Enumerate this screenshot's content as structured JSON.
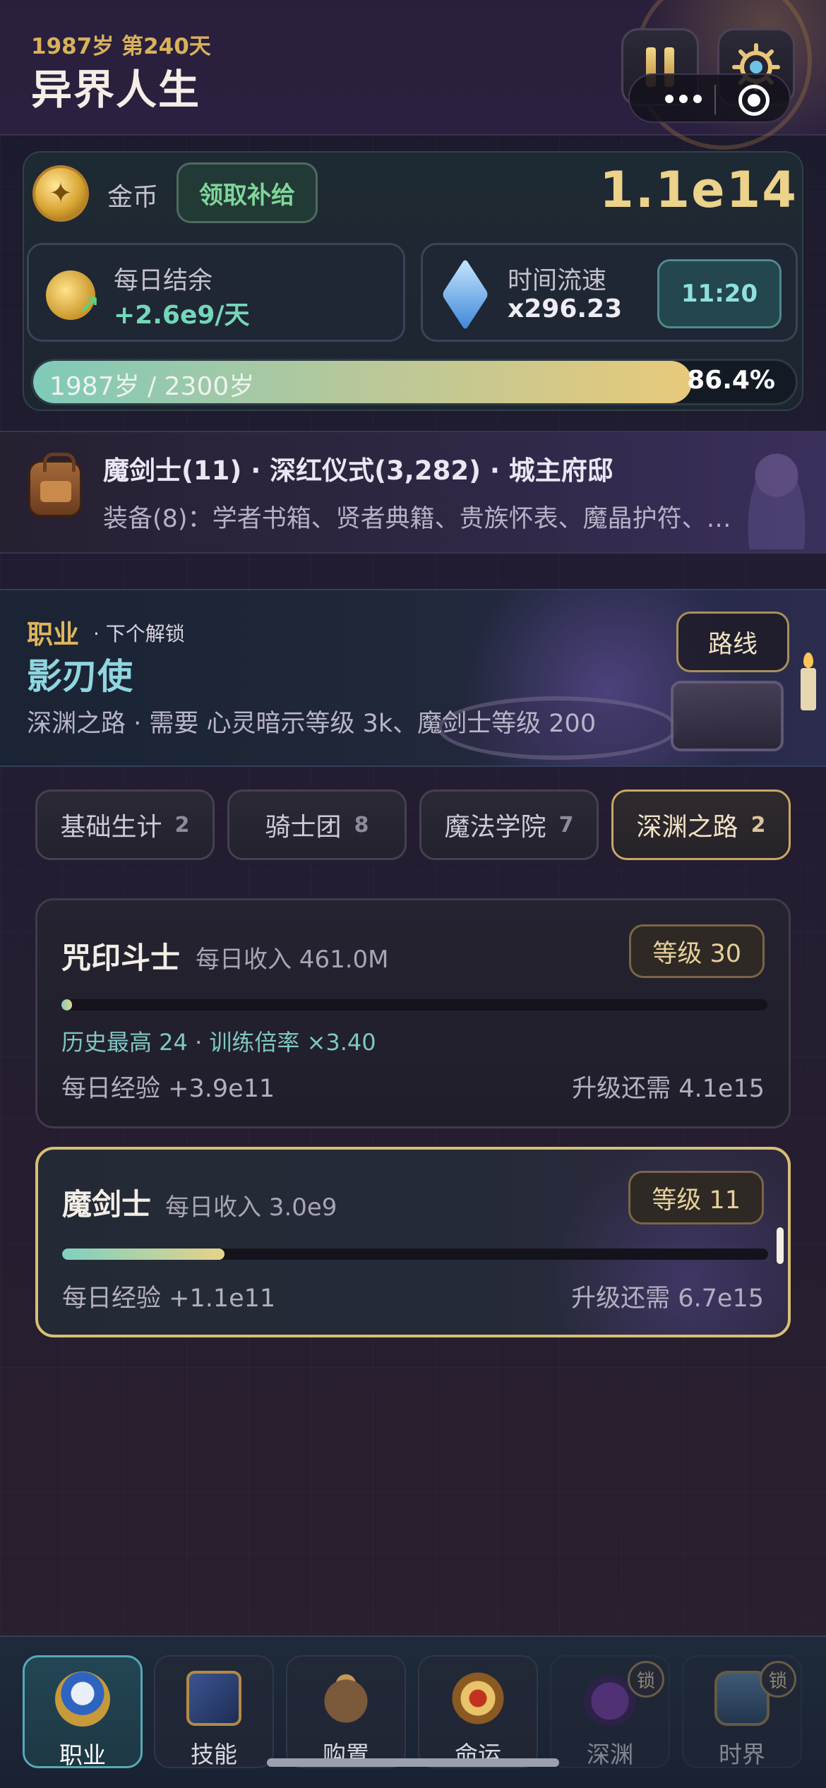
{
  "header": {
    "age_day": "1987岁 第240天",
    "title": "异界人生"
  },
  "resources": {
    "coin_label": "金币",
    "claim_label": "领取补给",
    "coin_value": "1.1e14",
    "daily_label": "每日结余",
    "daily_value": "+2.6e9/天",
    "speed_label": "时间流速",
    "speed_value": "x296.23",
    "clock": "11:20",
    "life_text": "1987岁 / 2300岁",
    "life_pct": "86.4%",
    "life_fraction": 0.864
  },
  "status": {
    "line": "魔剑士(11) · 深红仪式(3,282) · 城主府邸",
    "equipment": "装备(8)：学者书箱、贤者典籍、贵族怀表、魔晶护符、…"
  },
  "unlock": {
    "section_label": "职业",
    "next_label": "· 下个解锁",
    "next_job": "影刃使",
    "requirement": "深渊之路 · 需要 心灵暗示等级 3k、魔剑士等级 200",
    "route_button": "路线"
  },
  "tabs": [
    {
      "label": "基础生计",
      "count": "2"
    },
    {
      "label": "骑士团",
      "count": "8"
    },
    {
      "label": "魔法学院",
      "count": "7"
    },
    {
      "label": "深渊之路",
      "count": "2"
    }
  ],
  "jobs": [
    {
      "name": "咒印斗士",
      "income": "每日收入 461.0M",
      "level": "等级 30",
      "progress": 0.01,
      "note": "历史最高 24 · 训练倍率 ×3.40",
      "daily_exp": "每日经验 +3.9e11",
      "need": "升级还需 4.1e15"
    },
    {
      "name": "魔剑士",
      "income": "每日收入 3.0e9",
      "level": "等级 11",
      "progress": 0.23,
      "daily_exp": "每日经验 +1.1e11",
      "need": "升级还需 6.7e15"
    }
  ],
  "nav": [
    {
      "label": "职业",
      "icon": "job-shield-icon"
    },
    {
      "label": "技能",
      "icon": "skill-book-icon"
    },
    {
      "label": "购置",
      "icon": "shop-bag-icon"
    },
    {
      "label": "命运",
      "icon": "fate-amulet-icon"
    },
    {
      "label": "深渊",
      "icon": "abyss-crystal-icon",
      "lock": "锁"
    },
    {
      "label": "时界",
      "icon": "time-world-icon",
      "lock": "锁"
    }
  ],
  "colors": {
    "gold": "#d8b15a",
    "teal": "#74d7b8",
    "active_border": "#d9bf73"
  }
}
